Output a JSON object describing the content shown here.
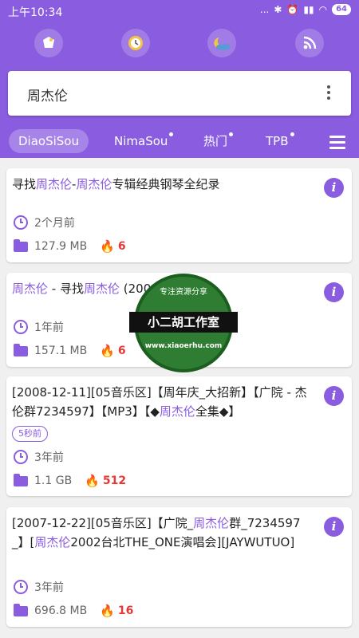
{
  "statusbar": {
    "time": "上午10:34",
    "signal_dots": "...",
    "battery": "64"
  },
  "colors": {
    "accent": "#8a5ce0",
    "heat": "#e53935",
    "background": "#f0f0f0"
  },
  "quick_icons": [
    "home-shield-icon",
    "clock-icon",
    "night-mode-icon",
    "rss-icon"
  ],
  "search": {
    "query": "周杰伦"
  },
  "tabs": [
    {
      "label": "DiaoSiSou",
      "active": true
    },
    {
      "label": "NimaSou",
      "dot": true
    },
    {
      "label": "热门",
      "dot": true
    },
    {
      "label": "TPB",
      "dot": true
    }
  ],
  "results": [
    {
      "title_parts": [
        "寻找",
        "周杰伦",
        "-",
        "周杰伦",
        "专辑经典钢琴全纪录"
      ],
      "age": "2个月前",
      "size": "127.9 MB",
      "heat": "6"
    },
    {
      "title_parts": [
        "周杰伦",
        " - 寻找",
        "周杰伦",
        " (200",
        "",
        "...】"
      ],
      "age": "1年前",
      "size": "157.1 MB",
      "heat": "6"
    },
    {
      "title_parts": [
        "[2008-12-11][05音乐区]【周年庆_大招新】【广院 - 杰伦群7234597】【MP3】【◆",
        "周杰伦",
        "全集◆】"
      ],
      "badge": "5秒前",
      "age": "3年前",
      "size": "1.1 GB",
      "heat": "512"
    },
    {
      "title_parts": [
        "[2007-12-22][05音乐区]【广院_",
        "周杰伦",
        "群_7234597_】[",
        "周杰伦",
        "2002台北THE_ONE演唱会][JAYWUTUO]"
      ],
      "age": "3年前",
      "size": "696.8 MB",
      "heat": "16"
    }
  ],
  "watermark": {
    "top": "专注资源分享",
    "band": "小二胡工作室",
    "bottom": "www.xiaoerhu.com"
  }
}
